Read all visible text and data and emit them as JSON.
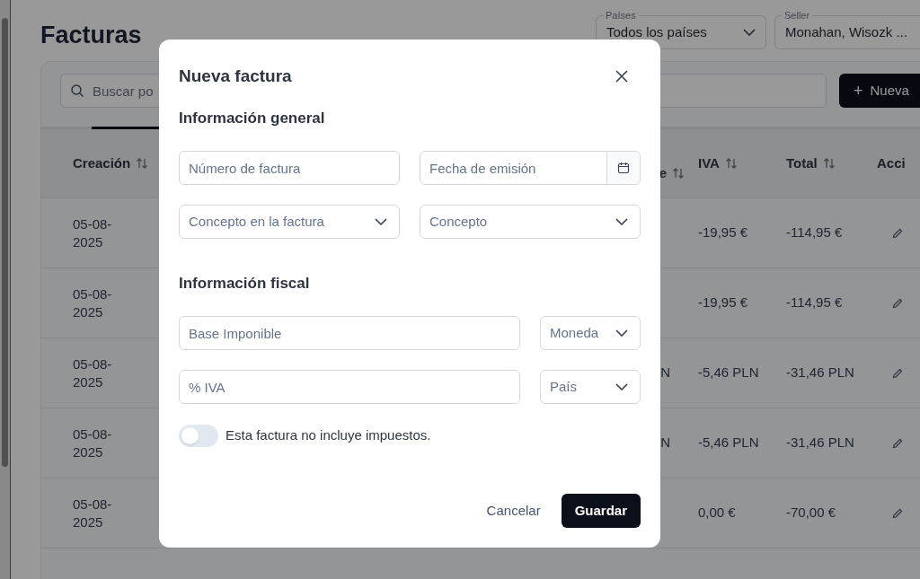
{
  "page": {
    "title": "Facturas"
  },
  "filters": [
    {
      "label": "Países",
      "value": "Todos los países"
    },
    {
      "label": "Seller",
      "value": "Monahan, Wisozk ..."
    }
  ],
  "search": {
    "placeholder": "Buscar po"
  },
  "new_button": {
    "icon": "+",
    "label": "Nueva"
  },
  "table": {
    "columns": [
      {
        "label": "Creación",
        "sortable": true
      },
      {
        "label": "e",
        "sortable": true
      },
      {
        "label": "IVA",
        "sortable": true
      },
      {
        "label": "Total",
        "sortable": true
      },
      {
        "label": "Acci",
        "sortable": false
      }
    ],
    "rows": [
      {
        "created": "05-08-2025",
        "iva": "-19,95 €",
        "total": "-114,95 €"
      },
      {
        "created": "05-08-2025",
        "iva": "-19,95 €",
        "total": "-114,95 €"
      },
      {
        "created": "05-08-2025",
        "column_2": "N",
        "iva": "-5,46 PLN",
        "total": "-31,46 PLN"
      },
      {
        "created": "05-08-2025",
        "column_2": "N",
        "iva": "-5,46 PLN",
        "total": "-31,46 PLN"
      },
      {
        "created": "05-08-2025",
        "iva": "0,00 €",
        "total": "-70,00 €"
      }
    ]
  },
  "modal": {
    "title": "Nueva factura",
    "sections": [
      {
        "heading": "Información general",
        "kind": "paired",
        "fields": [
          {
            "kind": "text",
            "placeholder": "Número de factura"
          },
          {
            "kind": "date",
            "placeholder": "Fecha de emisión"
          },
          {
            "kind": "select",
            "placeholder": "Concepto en la factura"
          },
          {
            "kind": "select",
            "placeholder": "Concepto"
          }
        ]
      },
      {
        "heading": "Información fiscal",
        "kind": "split",
        "fields": [
          {
            "kind": "text",
            "placeholder": "Base Imponible"
          },
          {
            "kind": "select",
            "placeholder": "Moneda"
          },
          {
            "kind": "text",
            "placeholder": "% IVA"
          },
          {
            "kind": "select",
            "placeholder": "País"
          }
        ]
      }
    ],
    "toggle": {
      "label": "Esta factura no incluye impuestos.",
      "on": false
    },
    "actions": [
      {
        "kind": "secondary",
        "label": "Cancelar"
      },
      {
        "kind": "primary",
        "label": "Guardar"
      }
    ]
  }
}
